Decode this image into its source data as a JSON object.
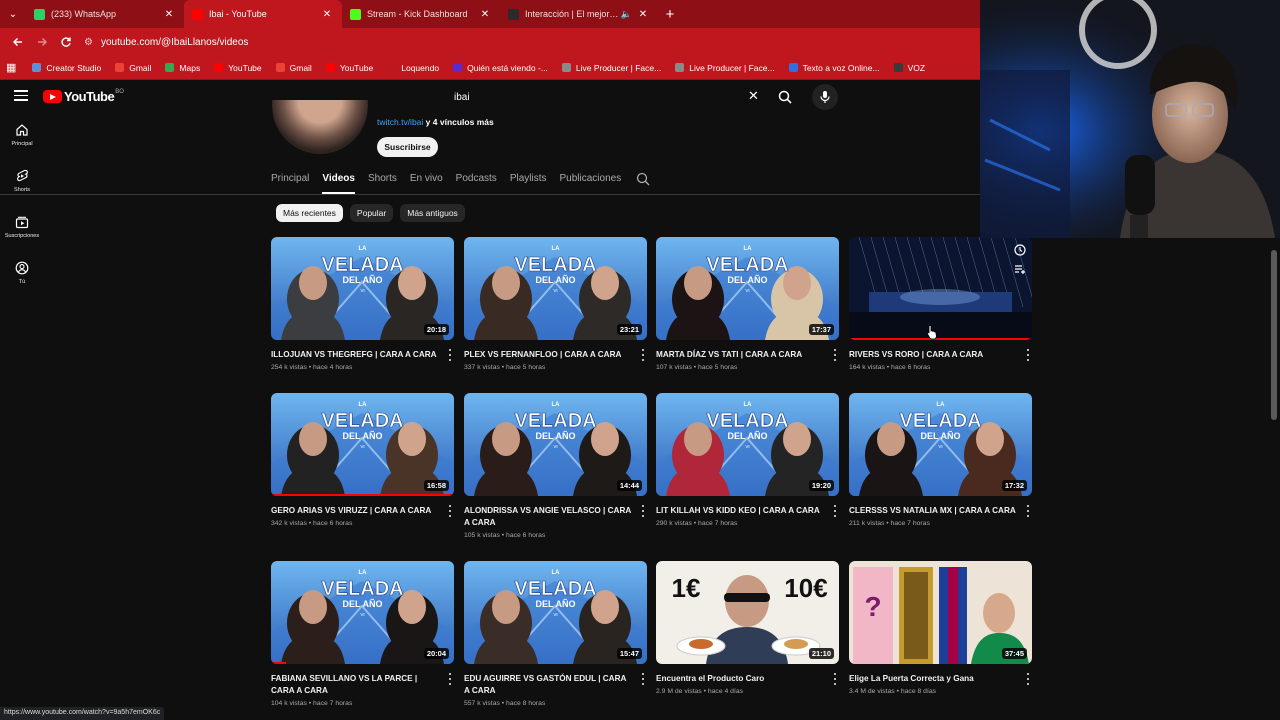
{
  "browser": {
    "tabs": [
      {
        "label": "(233) WhatsApp",
        "color": "#25d366",
        "active": false,
        "muted": false
      },
      {
        "label": "Ibai - YouTube",
        "color": "#ff0000",
        "active": true,
        "muted": false
      },
      {
        "label": "Stream - Kick Dashboard",
        "color": "#53fc18",
        "active": false,
        "muted": false
      },
      {
        "label": "Interacción | El mejor softw",
        "color": "#2b2b2b",
        "active": false,
        "muted": true
      }
    ],
    "url": "youtube.com/@IbaiLlanos/videos",
    "bookmarks": [
      {
        "label": "Creator Studio",
        "color": "#5f8fd9"
      },
      {
        "label": "Gmail",
        "color": "#ea4335"
      },
      {
        "label": "Maps",
        "color": "#34a853"
      },
      {
        "label": "YouTube",
        "color": "#ff0000"
      },
      {
        "label": "Gmail",
        "color": "#ea4335"
      },
      {
        "label": "YouTube",
        "color": "#ff0000"
      },
      {
        "label": "Loquendo",
        "color": "#c0161d"
      },
      {
        "label": "Quién está viendo -...",
        "color": "#5b2bcf"
      },
      {
        "label": "Live Producer | Face...",
        "color": "#8a8a8a"
      },
      {
        "label": "Live Producer | Face...",
        "color": "#8a8a8a"
      },
      {
        "label": "Texto a voz Online...",
        "color": "#2f6fe0"
      },
      {
        "label": "VOZ",
        "color": "#3a3a3a"
      }
    ]
  },
  "youtube": {
    "logo_text": "YouTube",
    "logo_country": "BO",
    "search_value": "ibai",
    "sidebar": [
      {
        "label": "Principal",
        "icon": "home-icon"
      },
      {
        "label": "Shorts",
        "icon": "shorts-icon"
      },
      {
        "label": "Suscripciones",
        "icon": "subscriptions-icon"
      },
      {
        "label": "Tú",
        "icon": "you-icon"
      }
    ],
    "channel": {
      "link": "twitch.tv/ibai",
      "more_links": "y 4 vínculos más",
      "subscribe": "Suscribirse"
    },
    "tabs": [
      "Principal",
      "Videos",
      "Shorts",
      "En vivo",
      "Podcasts",
      "Playlists",
      "Publicaciones"
    ],
    "active_tab": "Videos",
    "chips": [
      "Más recientes",
      "Popular",
      "Más antiguos"
    ],
    "active_chip": "Más recientes",
    "videos": [
      {
        "title": "ILLOJUAN VS THEGREFG | CARA A CARA",
        "meta": "254 k vistas • hace 4 horas",
        "duration": "20:18",
        "progress": 0.0,
        "thumb": "velada",
        "left": "#3b3d40",
        "right": "#2a2624"
      },
      {
        "title": "PLEX VS FERNANFLOO | CARA A CARA",
        "meta": "337 k vistas • hace 5 horas",
        "duration": "23:21",
        "progress": 0.0,
        "thumb": "velada",
        "left": "#3a2a24",
        "right": "#2e2a28"
      },
      {
        "title": "MARTA DÍAZ VS TATI | CARA A CARA",
        "meta": "107 k vistas • hace 5 horas",
        "duration": "17:37",
        "progress": 0.0,
        "thumb": "velada",
        "left": "#1c1414",
        "right": "#d8c4a6"
      },
      {
        "title": "RIVERS VS RORO | CARA A CARA",
        "meta": "164 k vistas • hace 6 horas",
        "duration": "",
        "progress": 1.0,
        "thumb": "stage",
        "left": "",
        "right": ""
      },
      {
        "title": "GERO ARIAS VS VIRUZZ | CARA A CARA",
        "meta": "342 k vistas • hace 6 horas",
        "duration": "16:58",
        "progress": 1.0,
        "thumb": "velada",
        "left": "#222222",
        "right": "#4a3428"
      },
      {
        "title": "ALONDRISSA VS ANGIE VELASCO | CARA A CARA",
        "meta": "105 k vistas • hace 6 horas",
        "duration": "14:44",
        "progress": 0.0,
        "thumb": "velada",
        "left": "#2a1c18",
        "right": "#1e1a18"
      },
      {
        "title": "LIT KILLAH VS KIDD KEO | CARA A CARA",
        "meta": "290 k vistas • hace 7 horas",
        "duration": "19:20",
        "progress": 0.0,
        "thumb": "velada",
        "left": "#b0273a",
        "right": "#242424"
      },
      {
        "title": "CLERSSS VS NATALIA MX | CARA A CARA",
        "meta": "211 k vistas • hace 7 horas",
        "duration": "17:32",
        "progress": 0.0,
        "thumb": "velada",
        "left": "#1a1414",
        "right": "#4a2a1e"
      },
      {
        "title": "FABIANA SEVILLANO VS LA PARCE | CARA A CARA",
        "meta": "104 k vistas • hace 7 horas",
        "duration": "20:04",
        "progress": 0.08,
        "thumb": "velada",
        "left": "#2c1e1a",
        "right": "#1a1616"
      },
      {
        "title": "EDU AGUIRRE VS GASTÓN EDUL | CARA A CARA",
        "meta": "557 k vistas • hace 8 horas",
        "duration": "15:47",
        "progress": 0.0,
        "thumb": "velada",
        "left": "#3a2c26",
        "right": "#2a2420"
      },
      {
        "title": "Encuentra el Producto Caro",
        "meta": "2.9 M de vistas • hace 4 días",
        "duration": "21:10",
        "progress": 0.0,
        "thumb": "food",
        "left": "",
        "right": "",
        "thumb_text_left": "1€",
        "thumb_text_right": "10€"
      },
      {
        "title": "Elige La Puerta Correcta y Gana",
        "meta": "3.4 M de vistas • hace 8 días",
        "duration": "37:45",
        "progress": 0.0,
        "thumb": "doors",
        "left": "",
        "right": "",
        "thumb_text_left": "?",
        "thumb_text_right": ""
      }
    ],
    "velada_text": {
      "top": "LA",
      "main": "VELADA",
      "sub": "DEL AÑO",
      "num": "VI"
    },
    "status_url": "https://www.youtube.com/watch?v=9a5h7emOK6c"
  },
  "colors": {
    "brand_red": "#ff0000",
    "chrome_red": "#c0161d",
    "bg": "#0f0f0f"
  }
}
